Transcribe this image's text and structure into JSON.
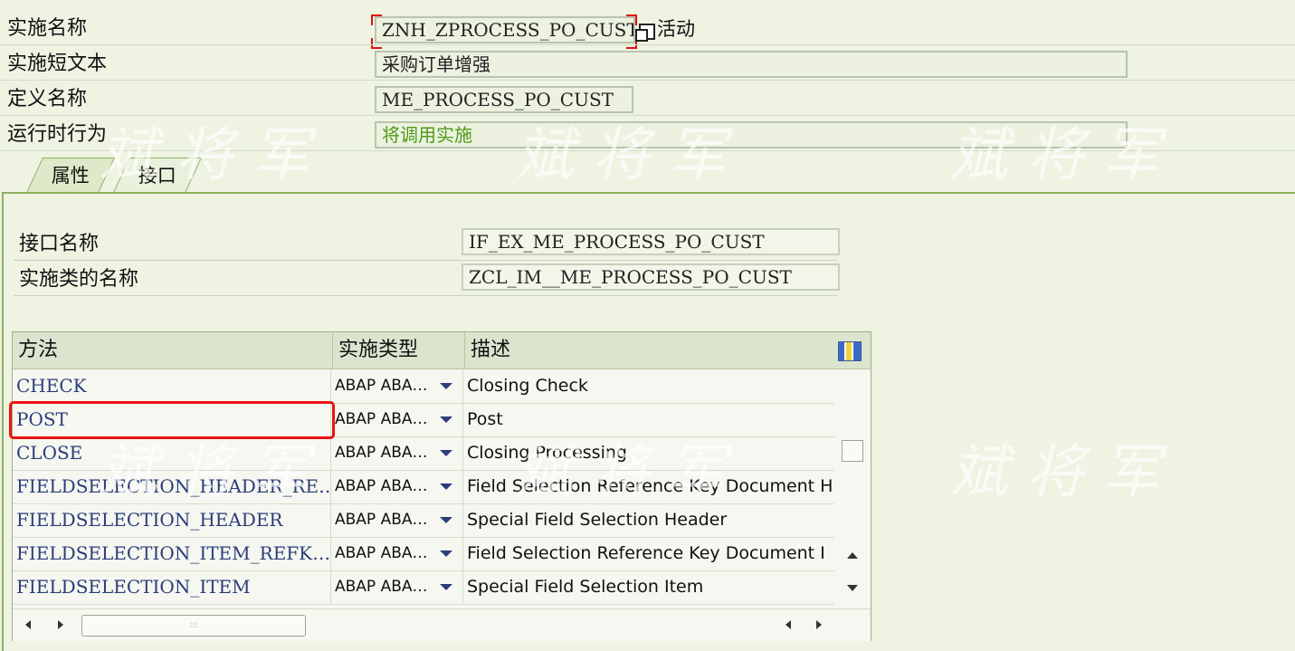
{
  "header": {
    "impl_name_label": "实施名称",
    "impl_name_value": "ZNH_ZPROCESS_PO_CUST",
    "impl_status": "活动",
    "short_text_label": "实施短文本",
    "short_text_value": "采购订单增强",
    "def_name_label": "定义名称",
    "def_name_value": "ME_PROCESS_PO_CUST",
    "runtime_label": "运行时行为",
    "runtime_value": "将调用实施"
  },
  "tabs": [
    {
      "label": "属性"
    },
    {
      "label": "接口"
    }
  ],
  "interface": {
    "name_label": "接口名称",
    "name_value": "IF_EX_ME_PROCESS_PO_CUST",
    "class_label": "实施类的名称",
    "class_value": "ZCL_IM__ME_PROCESS_PO_CUST"
  },
  "grid": {
    "headers": [
      "方法",
      "实施类型",
      "描述"
    ],
    "rows": [
      {
        "method": "CHECK",
        "type": "ABAP ABA…",
        "desc": "Closing Check"
      },
      {
        "method": "POST",
        "type": "ABAP ABA…",
        "desc": "Post"
      },
      {
        "method": "CLOSE",
        "type": "ABAP ABA…",
        "desc": "Closing Processing"
      },
      {
        "method": "FIELDSELECTION_HEADER_RE…",
        "type": "ABAP ABA…",
        "desc": "Field Selection Reference Key Document H"
      },
      {
        "method": "FIELDSELECTION_HEADER",
        "type": "ABAP ABA…",
        "desc": "Special Field Selection Header"
      },
      {
        "method": "FIELDSELECTION_ITEM_REFK…",
        "type": "ABAP ABA…",
        "desc": "Field Selection Reference Key Document I"
      },
      {
        "method": "FIELDSELECTION_ITEM",
        "type": "ABAP ABA…",
        "desc": "Special Field Selection Item"
      }
    ],
    "hscroll_grip": ":::"
  },
  "watermark": "斌将军",
  "colors": {
    "accent_green": "#4e9a18",
    "highlight_red": "#e11",
    "tab_border": "#8fb060"
  }
}
